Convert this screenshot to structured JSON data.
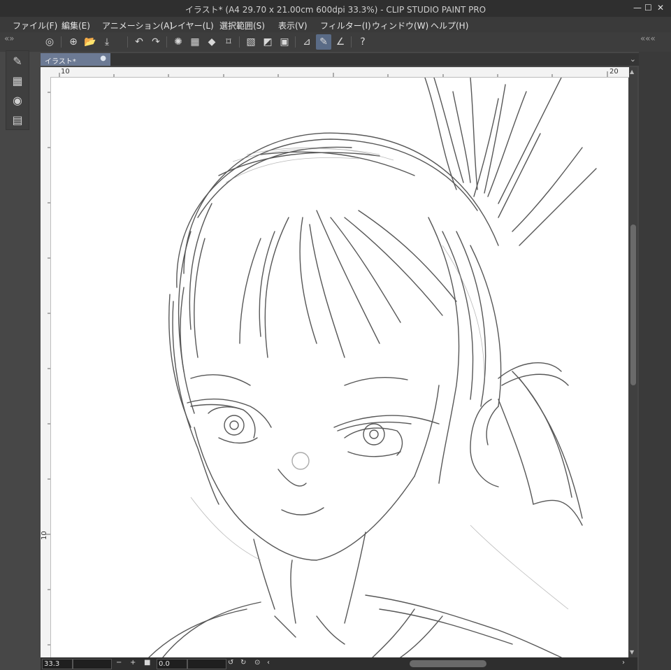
{
  "window": {
    "title": "イラスト* (A4 29.70 x 21.00cm 600dpi 33.3%)  - CLIP STUDIO PAINT PRO",
    "minimize_glyph": "—",
    "maximize_glyph": "☐",
    "close_glyph": "✕"
  },
  "menu": [
    "ファイル(F)",
    "編集(E)",
    "アニメーション(A)",
    "レイヤー(L)",
    "選択範囲(S)",
    "表示(V)",
    "フィルター(I)",
    "ウィンドウ(W)",
    "ヘルプ(H)"
  ],
  "toolbar": {
    "icons": [
      "clip-studio-icon",
      "new-file-icon",
      "open-folder-icon",
      "save-icon",
      "undo-icon",
      "redo-icon",
      "loading-spinner-icon",
      "selection-icon",
      "fill-icon",
      "transform-icon",
      "deselect-icon",
      "invert-icon",
      "border-icon",
      "ruler-icon",
      "brush-active-icon",
      "stroke-icon",
      "help-icon"
    ],
    "glyphs": {
      "clip_studio": "◎",
      "new_file": "⊕",
      "open_folder": "📂",
      "save": "⤓",
      "undo": "↶",
      "redo": "↷",
      "spinner": "✺",
      "selection": "▦",
      "fill": "◆",
      "transform": "⌑",
      "deselect": "▧",
      "invert": "◩",
      "border": "▣",
      "ruler": "⊿",
      "brush": "✎",
      "stroke": "∠",
      "help": "?"
    },
    "left_chevron": "« »",
    "right_chevron": "« « «"
  },
  "left_strip": {
    "icons": [
      "pen-icon",
      "layer-palette-icon",
      "circle-icon",
      "film-icon"
    ],
    "glyphs": [
      "✎",
      "▦",
      "◉",
      "▤"
    ]
  },
  "document_tab": {
    "label": "イラスト*",
    "close_glyph": "●",
    "tab_chevron": "⌄"
  },
  "rulers": {
    "horizontal_labels": [
      "10",
      "20"
    ],
    "vertical_labels": [
      "10"
    ]
  },
  "canvas": {
    "subject": "pencil sketch of a girl with ponytail"
  },
  "status": {
    "zoom": "33.3",
    "zoom_out_glyph": "−",
    "zoom_in_glyph": "+",
    "fit_glyph": "■",
    "rotation": "0.0",
    "rotate_left_glyph": "↺",
    "rotate_right_glyph": "↻",
    "reset_glyph": "⊙",
    "scroll_left_glyph": "‹",
    "scroll_right_glyph": "›"
  },
  "colors": {
    "active_tab": "#6c7a94",
    "active_tool": "#5a6b86",
    "background": "#474747"
  }
}
